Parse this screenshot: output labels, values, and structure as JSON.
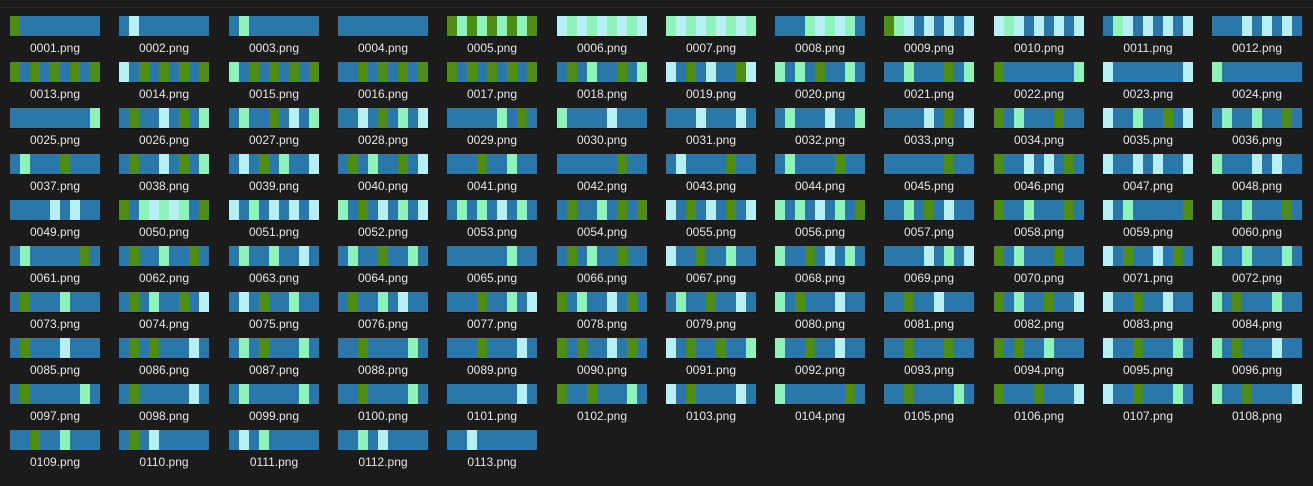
{
  "palette": {
    "background": "#1b1b1b",
    "blue": "#2a77aa",
    "green": "#4e8c14",
    "light": "#b6f0f5",
    "mint": "#8ef3bb",
    "label": "#e6e6e6"
  },
  "files": [
    {
      "name": "0001.png",
      "pattern": "GBBBBBBBB"
    },
    {
      "name": "0002.png",
      "pattern": "BLBBBBBBB"
    },
    {
      "name": "0003.png",
      "pattern": "BMBBBBBBB"
    },
    {
      "name": "0004.png",
      "pattern": "BBBBBBBBB"
    },
    {
      "name": "0005.png",
      "pattern": "GMGMGMGMG"
    },
    {
      "name": "0006.png",
      "pattern": "LMLMLMLML"
    },
    {
      "name": "0007.png",
      "pattern": "MLMLMLMLM"
    },
    {
      "name": "0008.png",
      "pattern": "BBBMLMLMB"
    },
    {
      "name": "0009.png",
      "pattern": "GMLBLBLBL"
    },
    {
      "name": "0010.png",
      "pattern": "LMLBLBLBL"
    },
    {
      "name": "0011.png",
      "pattern": "BMLBLBLBL"
    },
    {
      "name": "0012.png",
      "pattern": "BBBLBLBLB"
    },
    {
      "name": "0013.png",
      "pattern": "GBGBGBGBG"
    },
    {
      "name": "0014.png",
      "pattern": "LBGBGBGBG"
    },
    {
      "name": "0015.png",
      "pattern": "MBGBGBGBG"
    },
    {
      "name": "0016.png",
      "pattern": "BBGBGBGBG"
    },
    {
      "name": "0017.png",
      "pattern": "GBGBGBGBG"
    },
    {
      "name": "0018.png",
      "pattern": "BGBMBBGBM"
    },
    {
      "name": "0019.png",
      "pattern": "LBGBLBBGL"
    },
    {
      "name": "0020.png",
      "pattern": "MBMBGBBMB"
    },
    {
      "name": "0021.png",
      "pattern": "BBMBBBGBM"
    },
    {
      "name": "0022.png",
      "pattern": "GBBBBBBBM"
    },
    {
      "name": "0023.png",
      "pattern": "LBBBBBBBL"
    },
    {
      "name": "0024.png",
      "pattern": "MBBBBBBBB"
    },
    {
      "name": "0025.png",
      "pattern": "BBBBBBBBM"
    },
    {
      "name": "0026.png",
      "pattern": "BGBBLBGBM"
    },
    {
      "name": "0027.png",
      "pattern": "BMBBGBLBM"
    },
    {
      "name": "0028.png",
      "pattern": "BBLBGBMBL"
    },
    {
      "name": "0029.png",
      "pattern": "BBBBBMBGB"
    },
    {
      "name": "0030.png",
      "pattern": "MBBBBLBBB"
    },
    {
      "name": "0031.png",
      "pattern": "BBBLBBBLB"
    },
    {
      "name": "0032.png",
      "pattern": "BMBBBLBBM"
    },
    {
      "name": "0033.png",
      "pattern": "BBBBLBGBL"
    },
    {
      "name": "0034.png",
      "pattern": "GBMBBBGBB"
    },
    {
      "name": "0035.png",
      "pattern": "LBBMBBGBL"
    },
    {
      "name": "0036.png",
      "pattern": "BMBBMBBGB"
    },
    {
      "name": "0037.png",
      "pattern": "BMBBBGBBB"
    },
    {
      "name": "0038.png",
      "pattern": "BGBBLBGBM"
    },
    {
      "name": "0039.png",
      "pattern": "BLBGBMBBL"
    },
    {
      "name": "0040.png",
      "pattern": "BGBMBBGBL"
    },
    {
      "name": "0041.png",
      "pattern": "BBBGBBMBB"
    },
    {
      "name": "0042.png",
      "pattern": "BBBBBBGBB"
    },
    {
      "name": "0043.png",
      "pattern": "BLBBBBGBB"
    },
    {
      "name": "0044.png",
      "pattern": "BMBBBBGBB"
    },
    {
      "name": "0045.png",
      "pattern": "BBBBBBGBB"
    },
    {
      "name": "0046.png",
      "pattern": "GBBLBLBGB"
    },
    {
      "name": "0047.png",
      "pattern": "LBBLBLBBL"
    },
    {
      "name": "0048.png",
      "pattern": "MBBBLBLBB"
    },
    {
      "name": "0049.png",
      "pattern": "BBBBLBLBB"
    },
    {
      "name": "0050.png",
      "pattern": "GBMLMLMBG"
    },
    {
      "name": "0051.png",
      "pattern": "LBMBLBLBL"
    },
    {
      "name": "0052.png",
      "pattern": "MBGBLBMBL"
    },
    {
      "name": "0053.png",
      "pattern": "BMBMBLBMB"
    },
    {
      "name": "0054.png",
      "pattern": "BGBBMBGBG"
    },
    {
      "name": "0055.png",
      "pattern": "LBGBLBGBL"
    },
    {
      "name": "0056.png",
      "pattern": "MBMBLBMBG"
    },
    {
      "name": "0057.png",
      "pattern": "BBMBGBLBB"
    },
    {
      "name": "0058.png",
      "pattern": "GBBMBBBGB"
    },
    {
      "name": "0059.png",
      "pattern": "LBMBBBBBG"
    },
    {
      "name": "0060.png",
      "pattern": "MBBMBBBGB"
    },
    {
      "name": "0061.png",
      "pattern": "BMBBBBBGB"
    },
    {
      "name": "0062.png",
      "pattern": "BGBBMBBGB"
    },
    {
      "name": "0063.png",
      "pattern": "BMBBMBBLB"
    },
    {
      "name": "0064.png",
      "pattern": "BMBBGBBMB"
    },
    {
      "name": "0065.png",
      "pattern": "BBBBBBMBB"
    },
    {
      "name": "0066.png",
      "pattern": "BGBMBBGBB"
    },
    {
      "name": "0067.png",
      "pattern": "LBBGBBMBB"
    },
    {
      "name": "0068.png",
      "pattern": "MBBGBLBMB"
    },
    {
      "name": "0069.png",
      "pattern": "BBBBLBMBL"
    },
    {
      "name": "0070.png",
      "pattern": "GBMBBBGBB"
    },
    {
      "name": "0071.png",
      "pattern": "LBGBBLBGB"
    },
    {
      "name": "0072.png",
      "pattern": "MBBMBBBMB"
    },
    {
      "name": "0073.png",
      "pattern": "BGBBBMBBB"
    },
    {
      "name": "0074.png",
      "pattern": "BGBMBBGBL"
    },
    {
      "name": "0075.png",
      "pattern": "BLBGBBMBB"
    },
    {
      "name": "0076.png",
      "pattern": "BGBBMBLBB"
    },
    {
      "name": "0077.png",
      "pattern": "BBBGBBMBL"
    },
    {
      "name": "0078.png",
      "pattern": "GBMBBLBGB"
    },
    {
      "name": "0079.png",
      "pattern": "BMBBGBBLB"
    },
    {
      "name": "0080.png",
      "pattern": "MBGBBBLBB"
    },
    {
      "name": "0081.png",
      "pattern": "BBGBBLBBB"
    },
    {
      "name": "0082.png",
      "pattern": "GBMBBGBBL"
    },
    {
      "name": "0083.png",
      "pattern": "LBBGBBLBB"
    },
    {
      "name": "0084.png",
      "pattern": "MBGBBBMBB"
    },
    {
      "name": "0085.png",
      "pattern": "BGBBBLBBB"
    },
    {
      "name": "0086.png",
      "pattern": "BGBGBBBLB"
    },
    {
      "name": "0087.png",
      "pattern": "BMBGBBBMB"
    },
    {
      "name": "0088.png",
      "pattern": "BBGBBBBMB"
    },
    {
      "name": "0089.png",
      "pattern": "BBBGBBBLB"
    },
    {
      "name": "0090.png",
      "pattern": "GBGBBLBGB"
    },
    {
      "name": "0091.png",
      "pattern": "LBGBBGBBM"
    },
    {
      "name": "0092.png",
      "pattern": "MBBGBBLBB"
    },
    {
      "name": "0093.png",
      "pattern": "BBGBBBGBB"
    },
    {
      "name": "0094.png",
      "pattern": "GBGBBMBBB"
    },
    {
      "name": "0095.png",
      "pattern": "LBBGBBBMB"
    },
    {
      "name": "0096.png",
      "pattern": "MBGBBBLBB"
    },
    {
      "name": "0097.png",
      "pattern": "BGBBBBBMB"
    },
    {
      "name": "0098.png",
      "pattern": "BGBBBBBLB"
    },
    {
      "name": "0099.png",
      "pattern": "BMBBBBBMB"
    },
    {
      "name": "0100.png",
      "pattern": "BBGBBBBMB"
    },
    {
      "name": "0101.png",
      "pattern": "BBBBBBBLB"
    },
    {
      "name": "0102.png",
      "pattern": "GBBGBBBMB"
    },
    {
      "name": "0103.png",
      "pattern": "LBGBBBBLB"
    },
    {
      "name": "0104.png",
      "pattern": "MBBBBBBGB"
    },
    {
      "name": "0105.png",
      "pattern": "BBGBBBBMB"
    },
    {
      "name": "0106.png",
      "pattern": "GBBBGBBBL"
    },
    {
      "name": "0107.png",
      "pattern": "LBBGBBBMB"
    },
    {
      "name": "0108.png",
      "pattern": "MBBGBBBBL"
    },
    {
      "name": "0109.png",
      "pattern": "BBGBBMBBB"
    },
    {
      "name": "0110.png",
      "pattern": "BGBLBBBBB"
    },
    {
      "name": "0111.png",
      "pattern": "BLBMBBBBB"
    },
    {
      "name": "0112.png",
      "pattern": "BBMBLBBBB"
    },
    {
      "name": "0113.png",
      "pattern": "BBLBBBBBB"
    }
  ]
}
